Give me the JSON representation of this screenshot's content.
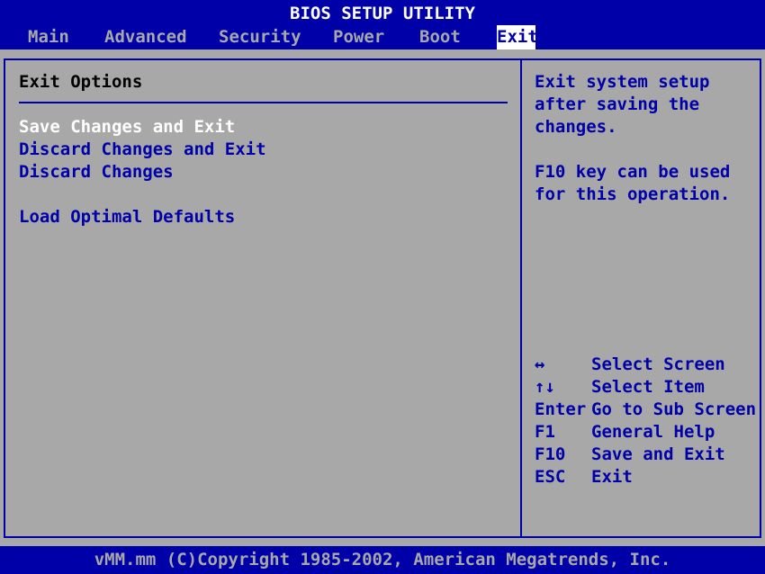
{
  "header": {
    "title": "BIOS SETUP UTILITY"
  },
  "menu": {
    "items": [
      {
        "label": "Main"
      },
      {
        "label": "Advanced"
      },
      {
        "label": "Security"
      },
      {
        "label": "Power"
      },
      {
        "label": "Boot"
      },
      {
        "label": "Exit",
        "active": true
      }
    ]
  },
  "left_pane": {
    "title": "Exit Options",
    "options": [
      {
        "label": "Save Changes and Exit",
        "selected": true
      },
      {
        "label": "Discard Changes and Exit"
      },
      {
        "label": "Discard Changes"
      },
      {
        "label": "Load Optimal Defaults"
      }
    ]
  },
  "help": {
    "lines": [
      "Exit system setup",
      "after saving the",
      "changes.",
      "",
      "F10 key can be used",
      "for this operation."
    ]
  },
  "keys": [
    {
      "key": "↔",
      "action": "Select Screen"
    },
    {
      "key": "↑↓",
      "action": "Select Item"
    },
    {
      "key": "Enter",
      "action": "Go to Sub Screen"
    },
    {
      "key": "F1",
      "action": "General Help"
    },
    {
      "key": "F10",
      "action": "Save and Exit"
    },
    {
      "key": "ESC",
      "action": "Exit"
    }
  ],
  "footer": {
    "text": "vMM.mm (C)Copyright 1985-2002, American Megatrends, Inc."
  },
  "colors": {
    "bios_blue": "#0000a8",
    "panel_gray": "#a8a8a8",
    "highlight_white": "#ffffff",
    "text_black": "#000000"
  }
}
